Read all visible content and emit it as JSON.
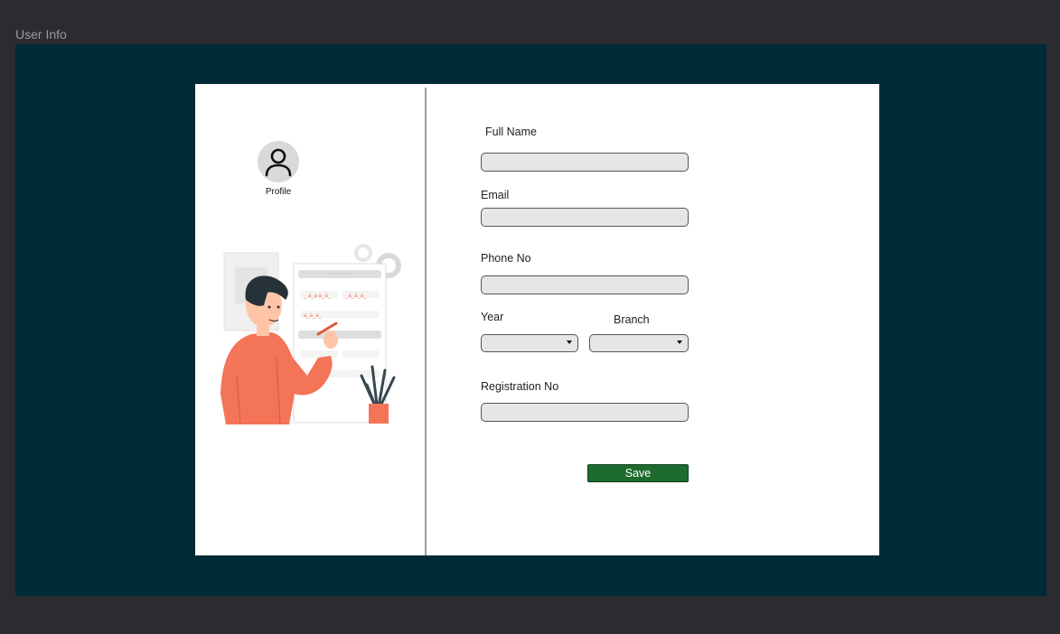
{
  "frame": {
    "title": "User Info"
  },
  "profile": {
    "label": "Profile"
  },
  "form": {
    "full_name": {
      "label": "Full Name",
      "value": ""
    },
    "email": {
      "label": "Email",
      "value": ""
    },
    "phone": {
      "label": "Phone No",
      "value": ""
    },
    "year": {
      "label": "Year",
      "value": ""
    },
    "branch": {
      "label": "Branch",
      "value": ""
    },
    "registration": {
      "label": "Registration No",
      "value": ""
    },
    "save_label": "Save"
  },
  "colors": {
    "canvas": "#002b36",
    "save_button": "#1e6b2f",
    "accent_illustration": "#f47458"
  }
}
